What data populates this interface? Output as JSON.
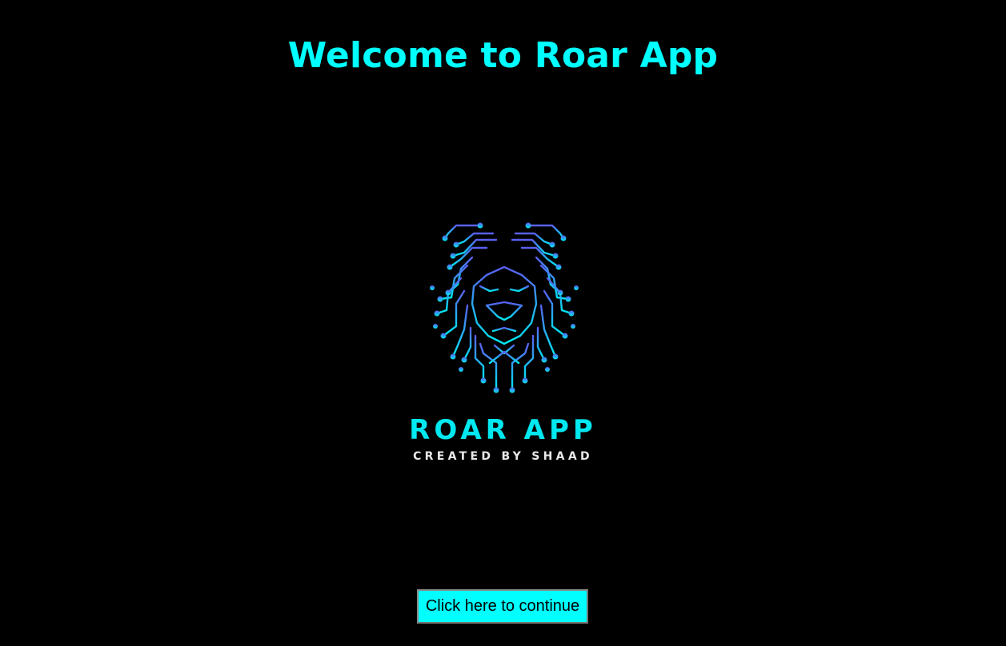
{
  "page": {
    "title": "Welcome to Roar App"
  },
  "logo": {
    "icon": "lion-circuit-logo",
    "brand_name": "ROAR APP",
    "credit": "CREATED BY SHAAD"
  },
  "continue_button": {
    "label": "Click here to continue"
  },
  "colors": {
    "background": "#000000",
    "title": "#00ffff",
    "button_bg": "#00ffff",
    "logo_gradient_top": "#5a5ef0",
    "logo_gradient_bottom": "#00e8f0"
  }
}
